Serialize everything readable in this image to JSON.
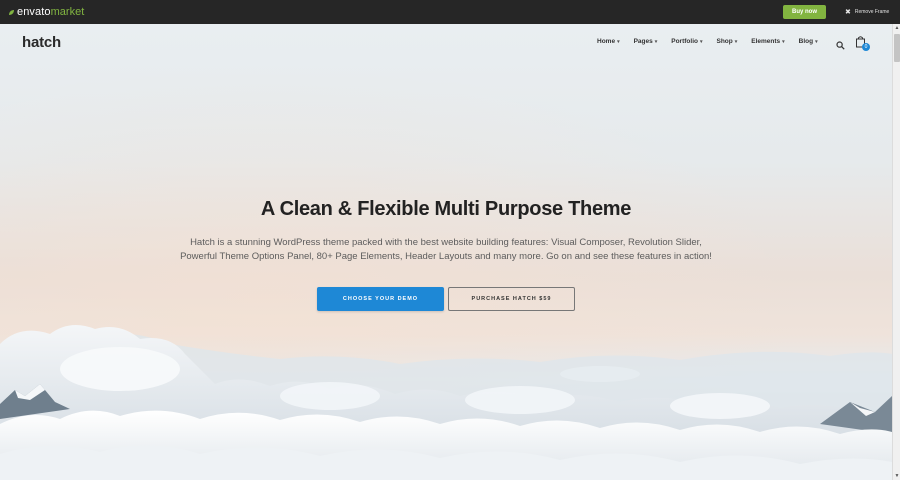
{
  "envato_bar": {
    "logo_word": "envato",
    "logo_market": "market",
    "buy_label": "Buy now",
    "remove_frame_label": "Remove Frame",
    "brand_color": "#82b440",
    "bar_color": "#262626"
  },
  "site": {
    "logo": "hatch",
    "nav": [
      {
        "label": "Home"
      },
      {
        "label": "Pages"
      },
      {
        "label": "Portfolio"
      },
      {
        "label": "Shop"
      },
      {
        "label": "Elements"
      },
      {
        "label": "Blog"
      }
    ],
    "cart_count": "0",
    "accent_color": "#1e88d6"
  },
  "hero": {
    "title": "A Clean & Flexible Multi Purpose Theme",
    "desc_line1": "Hatch is a stunning WordPress theme packed with the best website building features: Visual Composer, Revolution Slider,",
    "desc_line2": "Powerful Theme Options Panel, 80+ Page Elements, Header Layouts and many more. Go on and see these features in action!",
    "primary_button": "CHOOSE YOUR DEMO",
    "secondary_button": "PURCHASE HATCH $59"
  },
  "icons": {
    "search": "search-icon",
    "cart": "shopping-bag-icon",
    "leaf": "envato-leaf-icon",
    "close": "close-icon",
    "caret": "chevron-down-icon"
  }
}
